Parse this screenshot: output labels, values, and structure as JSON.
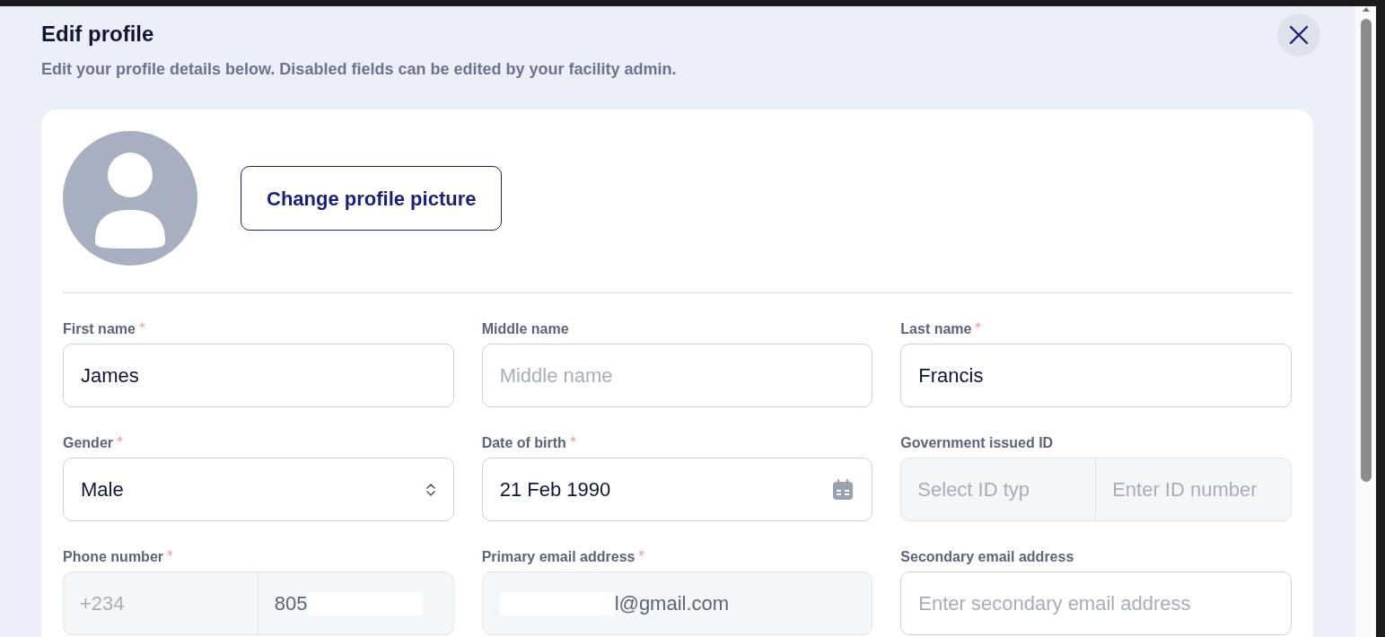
{
  "dialog": {
    "title": "Edif profile",
    "subtitle": "Edit your profile details below. Disabled fields can be edited by your facility admin."
  },
  "profile": {
    "button": "Change profile picture"
  },
  "fields": [
    {
      "kind": "text",
      "label": "First name",
      "required": true,
      "value": "James",
      "disabled": false
    },
    {
      "kind": "text",
      "label": "Middle name",
      "required": false,
      "placeholder": "Middle name",
      "disabled": false
    },
    {
      "kind": "text",
      "label": "Last name",
      "required": true,
      "value": "Francis",
      "disabled": false
    },
    {
      "kind": "select",
      "label": "Gender",
      "required": true,
      "value": "Male",
      "disabled": false
    },
    {
      "kind": "date",
      "label": "Date of birth",
      "required": true,
      "value": "21 Feb 1990",
      "disabled": false
    },
    {
      "kind": "pair",
      "label": "Government issued ID",
      "required": false,
      "placeholder": "Select ID typ",
      "placeholder_2": "Enter ID number",
      "disabled": true
    },
    {
      "kind": "pair",
      "label": "Phone number",
      "required": true,
      "placeholder": "+234",
      "value_2": "805",
      "redacted": true,
      "disabled": true
    },
    {
      "kind": "email",
      "label": "Primary email address",
      "required": true,
      "value": "l@gmail.com",
      "redacted": true,
      "disabled": true
    },
    {
      "kind": "text",
      "label": "Secondary email address",
      "required": false,
      "placeholder": "Enter secondary email address",
      "disabled": false
    }
  ]
}
